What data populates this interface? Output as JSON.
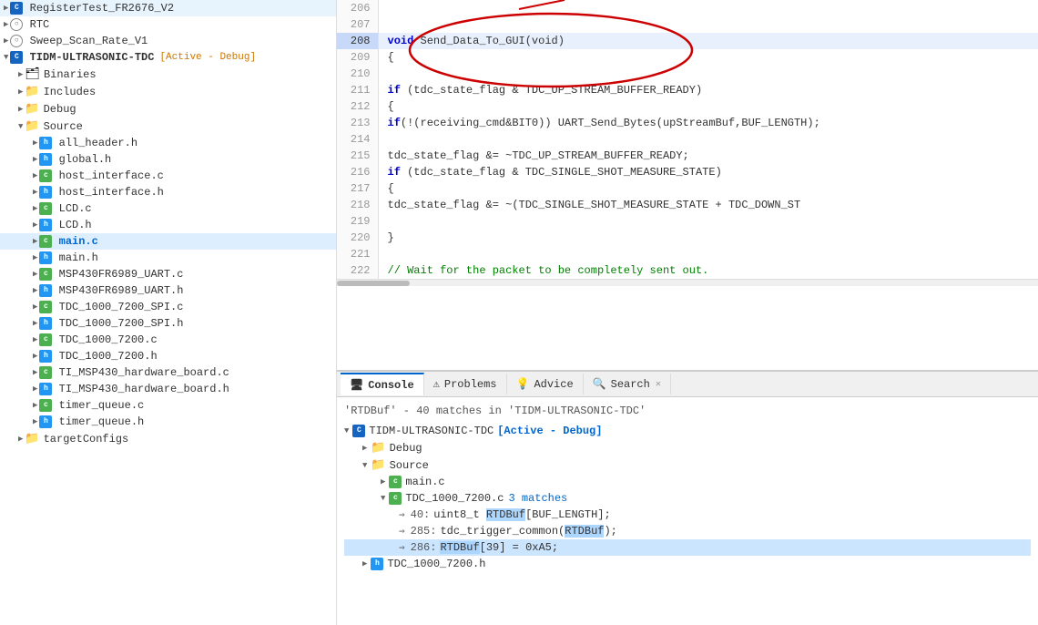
{
  "sidebar": {
    "items": [
      {
        "id": "RegisterTest",
        "label": "RegisterTest_FR2676_V2",
        "type": "ccs",
        "indent": 0,
        "expanded": false
      },
      {
        "id": "RTC",
        "label": "RTC",
        "type": "rtc",
        "indent": 0,
        "expanded": false
      },
      {
        "id": "Sweep",
        "label": "Sweep_Scan_Rate_V1",
        "type": "ccs",
        "indent": 0,
        "expanded": false
      },
      {
        "id": "TIDM",
        "label": "TIDM-ULTRASONIC-TDC",
        "type": "ccs-main",
        "indent": 0,
        "expanded": true,
        "badge": "[Active - Debug]"
      },
      {
        "id": "Binaries",
        "label": "Binaries",
        "type": "binaries",
        "indent": 1,
        "expanded": false
      },
      {
        "id": "Includes",
        "label": "Includes",
        "type": "includes",
        "indent": 1,
        "expanded": false
      },
      {
        "id": "Debug",
        "label": "Debug",
        "type": "folder",
        "indent": 1,
        "expanded": false
      },
      {
        "id": "Source",
        "label": "Source",
        "type": "folder",
        "indent": 1,
        "expanded": true
      },
      {
        "id": "all_header",
        "label": "all_header.h",
        "type": "h",
        "indent": 2,
        "expanded": false
      },
      {
        "id": "global",
        "label": "global.h",
        "type": "h",
        "indent": 2,
        "expanded": false
      },
      {
        "id": "host_interface_c",
        "label": "host_interface.c",
        "type": "c",
        "indent": 2,
        "expanded": false
      },
      {
        "id": "host_interface_h",
        "label": "host_interface.h",
        "type": "h",
        "indent": 2,
        "expanded": false
      },
      {
        "id": "LCD_c",
        "label": "LCD.c",
        "type": "c",
        "indent": 2,
        "expanded": false
      },
      {
        "id": "LCD_h",
        "label": "LCD.h",
        "type": "h",
        "indent": 2,
        "expanded": false
      },
      {
        "id": "main_c",
        "label": "main.c",
        "type": "c",
        "indent": 2,
        "expanded": false,
        "active": true
      },
      {
        "id": "main_h",
        "label": "main.h",
        "type": "h",
        "indent": 2,
        "expanded": false
      },
      {
        "id": "MSP430FR6989_UART_c",
        "label": "MSP430FR6989_UART.c",
        "type": "c",
        "indent": 2,
        "expanded": false
      },
      {
        "id": "MSP430FR6989_UART_h",
        "label": "MSP430FR6989_UART.h",
        "type": "h",
        "indent": 2,
        "expanded": false
      },
      {
        "id": "TDC_1000_7200_SPI_c",
        "label": "TDC_1000_7200_SPI.c",
        "type": "c",
        "indent": 2,
        "expanded": false
      },
      {
        "id": "TDC_1000_7200_SPI_h",
        "label": "TDC_1000_7200_SPI.h",
        "type": "h",
        "indent": 2,
        "expanded": false
      },
      {
        "id": "TDC_1000_7200_c",
        "label": "TDC_1000_7200.c",
        "type": "c",
        "indent": 2,
        "expanded": false
      },
      {
        "id": "TDC_1000_7200_h",
        "label": "TDC_1000_7200.h",
        "type": "h",
        "indent": 2,
        "expanded": false
      },
      {
        "id": "TI_MSP430_hardware_board_c",
        "label": "TI_MSP430_hardware_board.c",
        "type": "c",
        "indent": 2,
        "expanded": false
      },
      {
        "id": "TI_MSP430_hardware_board_h",
        "label": "TI_MSP430_hardware_board.h",
        "type": "h",
        "indent": 2,
        "expanded": false
      },
      {
        "id": "timer_queue_c",
        "label": "timer_queue.c",
        "type": "c",
        "indent": 2,
        "expanded": false
      },
      {
        "id": "timer_queue_h",
        "label": "timer_queue.h",
        "type": "h",
        "indent": 2,
        "expanded": false
      },
      {
        "id": "targetConfigs",
        "label": "targetConfigs",
        "type": "folder",
        "indent": 1,
        "expanded": false
      }
    ]
  },
  "code": {
    "lines": [
      {
        "num": 206,
        "content": "",
        "highlight": false
      },
      {
        "num": 207,
        "content": "",
        "highlight": false
      },
      {
        "num": 208,
        "content": "void Send_Data_To_GUI(void)",
        "highlight": true
      },
      {
        "num": 209,
        "content": "{",
        "highlight": false
      },
      {
        "num": 210,
        "content": "",
        "highlight": false
      },
      {
        "num": 211,
        "content": "    if (tdc_state_flag & TDC_UP_STREAM_BUFFER_READY)",
        "highlight": false
      },
      {
        "num": 212,
        "content": "    {",
        "highlight": false
      },
      {
        "num": 213,
        "content": "        if(!(receiving_cmd&BIT0))  UART_Send_Bytes(upStreamBuf,BUF_LENGTH);",
        "highlight": false
      },
      {
        "num": 214,
        "content": "",
        "highlight": false
      },
      {
        "num": 215,
        "content": "        tdc_state_flag &= ~TDC_UP_STREAM_BUFFER_READY;",
        "highlight": false
      },
      {
        "num": 216,
        "content": "        if (tdc_state_flag & TDC_SINGLE_SHOT_MEASURE_STATE)",
        "highlight": false
      },
      {
        "num": 217,
        "content": "        {",
        "highlight": false
      },
      {
        "num": 218,
        "content": "            tdc_state_flag &= ~(TDC_SINGLE_SHOT_MEASURE_STATE + TDC_DOWN_ST",
        "highlight": false
      },
      {
        "num": 219,
        "content": "",
        "highlight": false
      },
      {
        "num": 220,
        "content": "        }",
        "highlight": false
      },
      {
        "num": 221,
        "content": "",
        "highlight": false
      },
      {
        "num": 222,
        "content": "        // Wait for the packet to be completely sent out.",
        "highlight": false
      }
    ]
  },
  "bottom": {
    "tabs": [
      {
        "id": "console",
        "label": "Console",
        "icon": "console",
        "active": true
      },
      {
        "id": "problems",
        "label": "Problems",
        "icon": "problems",
        "active": false
      },
      {
        "id": "advice",
        "label": "Advice",
        "icon": "advice",
        "active": false
      },
      {
        "id": "search",
        "label": "Search",
        "icon": "search",
        "active": false,
        "closeable": true
      }
    ],
    "search": {
      "summary": "'RTDBuf' - 40 matches in 'TIDM-ULTRASONIC-TDC'",
      "project": {
        "name": "TIDM-ULTRASONIC-TDC",
        "badge": "[Active - Debug]",
        "children": [
          {
            "name": "Debug",
            "type": "folder",
            "expanded": false
          },
          {
            "name": "Source",
            "type": "folder",
            "expanded": true,
            "children": [
              {
                "name": "main.c",
                "type": "c",
                "expanded": false
              },
              {
                "name": "TDC_1000_7200.c",
                "type": "c",
                "badge": "3 matches",
                "expanded": true,
                "matches": [
                  {
                    "line": "40",
                    "text": "uint8_t RTDBuf[BUF_LENGTH];",
                    "match": "RTDBuf",
                    "selected": false
                  },
                  {
                    "line": "285",
                    "text": "tdc_trigger_common(RTDBuf);",
                    "match": "RTDBuf",
                    "selected": false
                  },
                  {
                    "line": "286",
                    "text": "RTDBuf[39] = 0xA5;",
                    "match": "RTDBuf",
                    "selected": true
                  }
                ]
              }
            ]
          },
          {
            "name": "TDC_1000_7200.h",
            "type": "h",
            "expanded": false
          }
        ]
      }
    }
  }
}
